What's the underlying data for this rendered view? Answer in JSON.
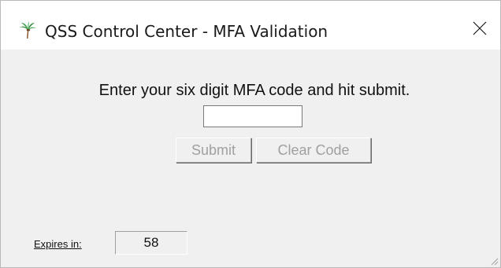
{
  "window": {
    "title": "QSS Control Center - MFA Validation",
    "app_icon": "palm-tree-icon",
    "close_icon": "close-icon"
  },
  "dialog": {
    "prompt": "Enter your six digit MFA code and hit submit.",
    "code_input": {
      "value": "",
      "placeholder": ""
    },
    "submit_label": "Submit",
    "clear_label": "Clear Code",
    "buttons_enabled": false
  },
  "expiry": {
    "label": "Expires in:",
    "value": "58"
  },
  "colors": {
    "window_bg": "#f0f0f0",
    "titlebar_bg": "#ffffff",
    "disabled_text": "#a0a0a0"
  }
}
